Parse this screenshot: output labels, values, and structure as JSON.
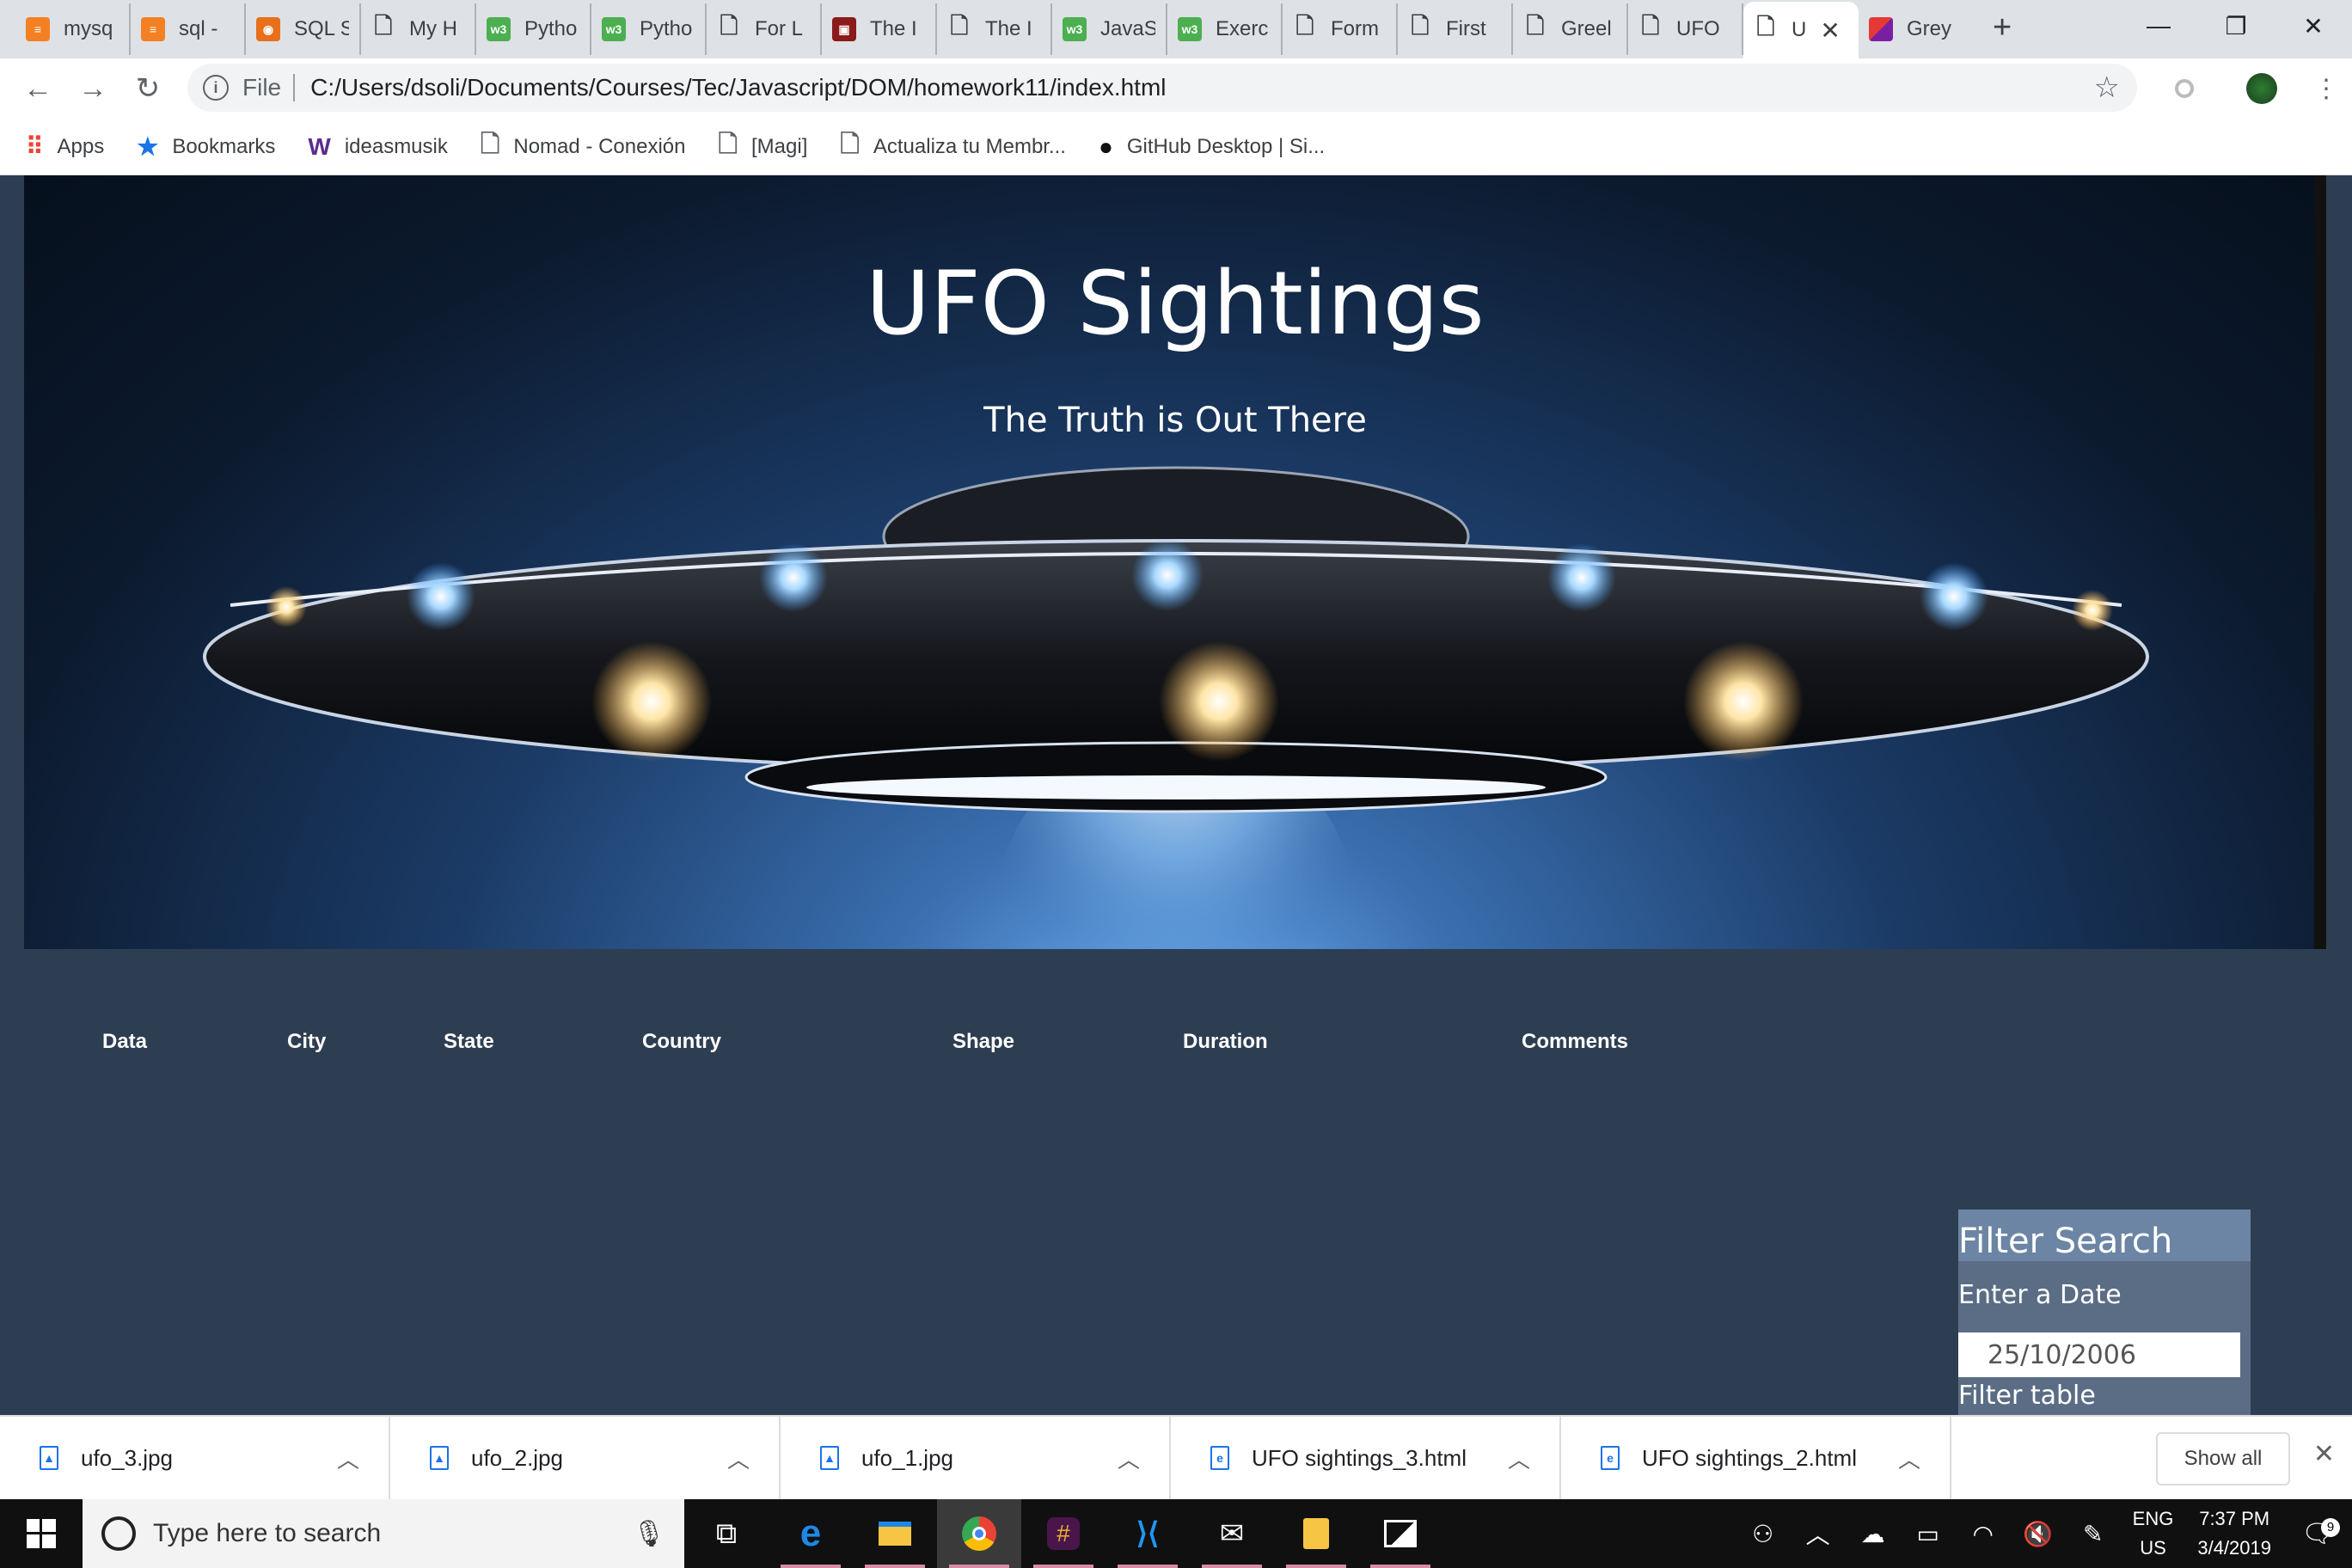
{
  "browser": {
    "tabs": [
      {
        "label": "mysq",
        "color": "#f48024",
        "glyph": "≡"
      },
      {
        "label": "sql -",
        "color": "#f48024",
        "glyph": "≡"
      },
      {
        "label": "SQL S",
        "color": "#e8701a",
        "glyph": "◉"
      },
      {
        "label": "My H",
        "color": "",
        "glyph": "🗋"
      },
      {
        "label": "Pytho",
        "color": "#4caf50",
        "glyph": "w3"
      },
      {
        "label": "Pytho",
        "color": "#4caf50",
        "glyph": "w3"
      },
      {
        "label": "For L",
        "color": "",
        "glyph": "🗋"
      },
      {
        "label": "The I",
        "color": "#8b1a1a",
        "glyph": "▣"
      },
      {
        "label": "The I",
        "color": "",
        "glyph": "🗋"
      },
      {
        "label": "JavaS",
        "color": "#4caf50",
        "glyph": "w3"
      },
      {
        "label": "Exerc",
        "color": "#4caf50",
        "glyph": "w3"
      },
      {
        "label": "Form",
        "color": "",
        "glyph": "🗋"
      },
      {
        "label": "First",
        "color": "",
        "glyph": "🗋"
      },
      {
        "label": "Greel",
        "color": "",
        "glyph": "🗋"
      },
      {
        "label": "UFO",
        "color": "",
        "glyph": "🗋"
      }
    ],
    "active_tab": "U",
    "last_tab": "Grey",
    "address": {
      "prefix": "File",
      "url": "C:/Users/dsoli/Documents/Courses/Tec/Javascript/DOM/homework11/index.html"
    },
    "bookmarks": [
      {
        "label": "Apps",
        "icon": "apps-grid-icon"
      },
      {
        "label": "Bookmarks",
        "icon": "star-icon"
      },
      {
        "label": "ideasmusik",
        "icon": "w-logo-icon"
      },
      {
        "label": "Nomad - Conexión",
        "icon": "page-icon"
      },
      {
        "label": "[Magi]",
        "icon": "page-icon"
      },
      {
        "label": "Actualiza tu Membr...",
        "icon": "page-icon"
      },
      {
        "label": "GitHub Desktop | Si...",
        "icon": "github-icon"
      }
    ]
  },
  "page": {
    "title": "UFO Sightings",
    "subtitle": "The Truth is Out There",
    "table_headers": [
      "Data",
      "City",
      "State",
      "Country",
      "Shape",
      "Duration",
      "Comments"
    ],
    "filter": {
      "heading": "Filter Search",
      "label": "Enter a Date",
      "input_value": "25/10/2006",
      "button": "Filter table"
    }
  },
  "downloads": {
    "items": [
      {
        "name": "ufo_3.jpg",
        "type": "image"
      },
      {
        "name": "ufo_2.jpg",
        "type": "image"
      },
      {
        "name": "ufo_1.jpg",
        "type": "image"
      },
      {
        "name": "UFO sightings_3.html",
        "type": "html"
      },
      {
        "name": "UFO sightings_2.html",
        "type": "html"
      }
    ],
    "show_all": "Show all"
  },
  "taskbar": {
    "search_placeholder": "Type here to search",
    "language": "ENG",
    "region": "US",
    "time": "7:37 PM",
    "date": "3/4/2019",
    "notifications": "9"
  }
}
